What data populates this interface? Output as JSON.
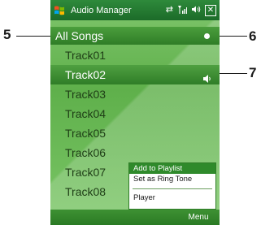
{
  "callouts": [
    "5",
    "6",
    "7"
  ],
  "title_bar": {
    "title": "Audio Manager",
    "icons": [
      "windows-start-icon",
      "connectivity-icon",
      "signal-icon",
      "volume-icon",
      "close-icon"
    ],
    "close_label": "✕"
  },
  "header": {
    "label": "All Songs"
  },
  "tracks": [
    "Track01",
    "Track02",
    "Track03",
    "Track04",
    "Track05",
    "Track06",
    "Track07",
    "Track08"
  ],
  "selected_track_index": 1,
  "context_menu": {
    "items": [
      "Add to Playlist",
      "Set as Ring Tone",
      "Player"
    ],
    "highlighted": "Add to Playlist"
  },
  "softkeys": {
    "right": "Menu"
  },
  "colors": {
    "accent": "#2f7d27",
    "background": "#6cba58",
    "title_bar": "#1c6b29"
  }
}
